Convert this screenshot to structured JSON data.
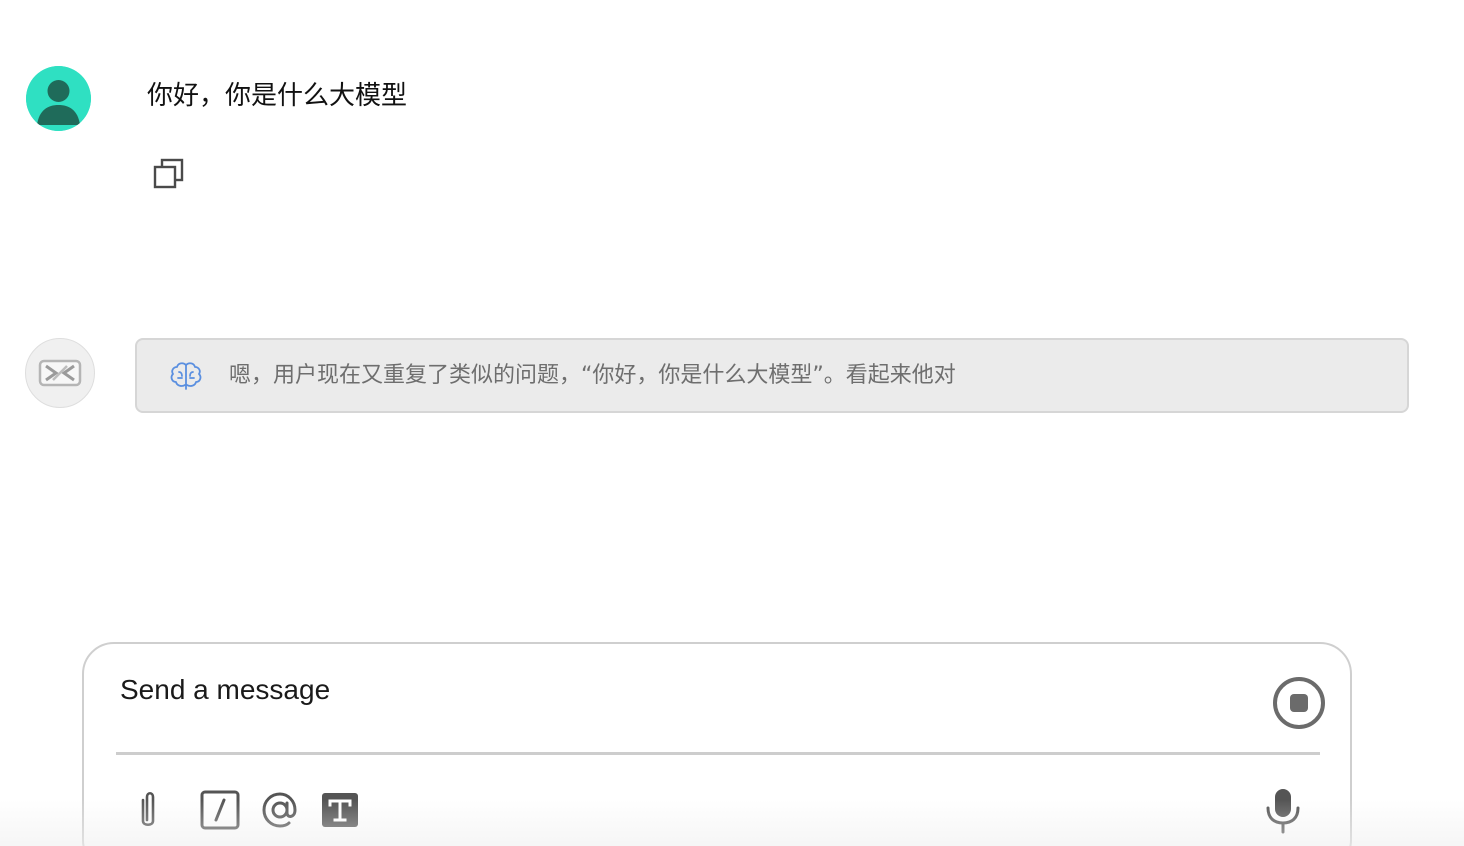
{
  "conversation": {
    "user_message": {
      "text": "你好，你是什么大模型"
    },
    "assistant_message": {
      "thinking_preview": "嗯，用户现在又重复了类似的问题，“你好，你是什么大模型”。看起来他对"
    }
  },
  "composer": {
    "placeholder": "Send a message"
  },
  "icons": {
    "user_avatar": "user-avatar-icon",
    "copy": "copy-icon",
    "bot_avatar": "model-logo-icon",
    "thinking": "brain-icon",
    "stop": "stop-icon",
    "attach": "paperclip-icon",
    "slash": "slash-command-icon",
    "mention": "at-mention-icon",
    "text_format": "text-format-icon",
    "microphone": "microphone-icon"
  },
  "colors": {
    "user_avatar_bg": "#2fe0c2",
    "user_avatar_figure": "#1f6b5a",
    "thinking_bg": "#ebebeb",
    "thinking_text": "#6e6e6e",
    "brain_icon": "#5a8fe0",
    "composer_border": "#cfcfcf"
  }
}
